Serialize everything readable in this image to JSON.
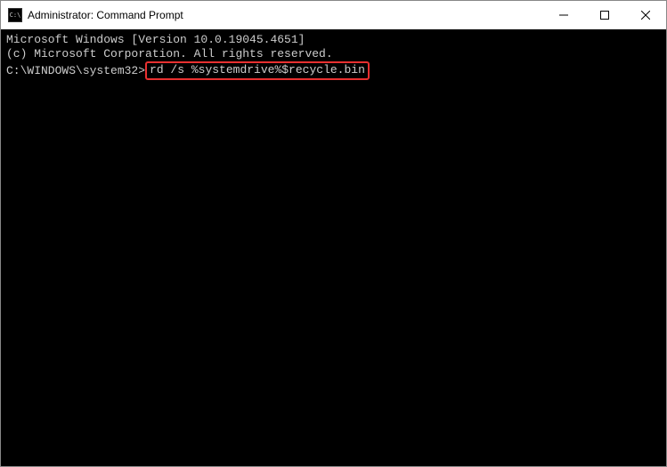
{
  "window": {
    "title": "Administrator: Command Prompt"
  },
  "terminal": {
    "line1": "Microsoft Windows [Version 10.0.19045.4651]",
    "line2": "(c) Microsoft Corporation. All rights reserved.",
    "blank": "",
    "prompt": "C:\\WINDOWS\\system32>",
    "command": "rd /s %systemdrive%$recycle.bin"
  }
}
